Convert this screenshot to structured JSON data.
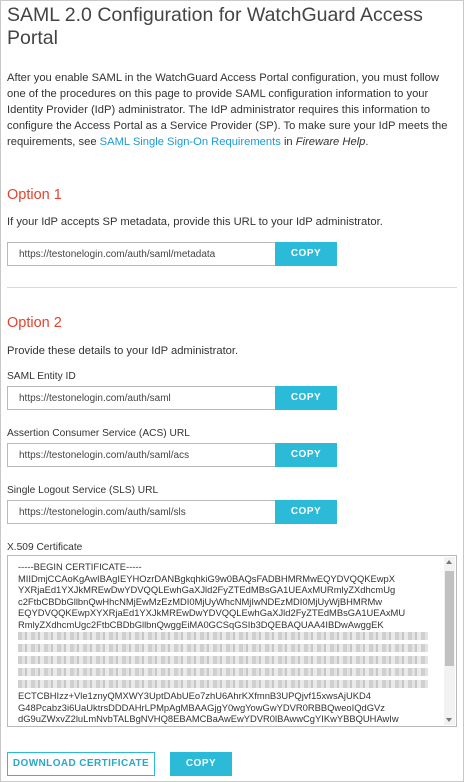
{
  "page": {
    "title": "SAML 2.0 Configuration for WatchGuard Access Portal",
    "intro_text": "After you enable SAML in the WatchGuard Access Portal configuration, you must follow one of the procedures on this page to provide SAML configuration information to your Identity Provider (IdP) administrator. The IdP administrator requires this information to configure the Access Portal as a Service Provider (SP). To make sure your IdP meets the requirements, see",
    "intro_link": "SAML Single Sign-On Requirements",
    "intro_in": "in",
    "intro_help": "Fireware Help",
    "intro_end": "."
  },
  "option1": {
    "heading": "Option 1",
    "text": "If your IdP accepts SP metadata, provide this URL to your IdP administrator.",
    "metadata_url": "https://testonelogin.com/auth/saml/metadata",
    "copy_label": "COPY"
  },
  "option2": {
    "heading": "Option 2",
    "text": "Provide these details to your IdP administrator.",
    "entity_id_label": "SAML Entity ID",
    "entity_id_value": "https://testonelogin.com/auth/saml",
    "acs_label": "Assertion Consumer Service (ACS) URL",
    "acs_value": "https://testonelogin.com/auth/saml/acs",
    "sls_label": "Single Logout Service (SLS) URL",
    "sls_value": "https://testonelogin.com/auth/saml/sls",
    "copy_label": "COPY",
    "cert_label": "X.509 Certificate",
    "cert_lines_top": [
      "-----BEGIN CERTIFICATE-----",
      "MIIDmjCCAoKgAwIBAgIEYHOzrDANBgkqhkiG9w0BAQsFADBHMRMwEQYDVQQKEwpX",
      "YXRjaEd1YXJkMREwDwYDVQQLEwhGaXJld2FyZTEdMBsGA1UEAxMURmlyZXdhcmUg",
      "c2FtbCBDbGllbnQwHhcNMjEwMzEzMDI0MjUyWhcNMjIwNDEzMDI0MjUyWjBHMRMw",
      "EQYDVQQKEwpXYXRjaEd1YXJkMREwDwYDVQQLEwhGaXJld2FyZTEdMBsGA1UEAxMU",
      "RmlyZXdhcmUgc2FtbCBDbGllbnQwggEiMA0GCSqGSIb3DQEBAQUAA4IBDwAwggEK"
    ],
    "cert_lines_bottom": [
      "ECTCBHIzz+Vle1znyQMXWY3UptDAbUEo7zhU6AhrKXfmnB3UPQjvf15xwsAjUKD4",
      "G48Pcabz3i6UaUktrsDDDAHrLPMpAgMBAAGjgY0wgYowGwYDVR0RBBQweoIQdGVz",
      "dG9uZWxvZ2luLmNvbTALBgNVHQ8EBAMCBaAwEwYDVR0lBAwwCgYIKwYBBQUHAwIw"
    ],
    "download_label": "DOWNLOAD CERTIFICATE",
    "cert_copy_label": "COPY"
  }
}
